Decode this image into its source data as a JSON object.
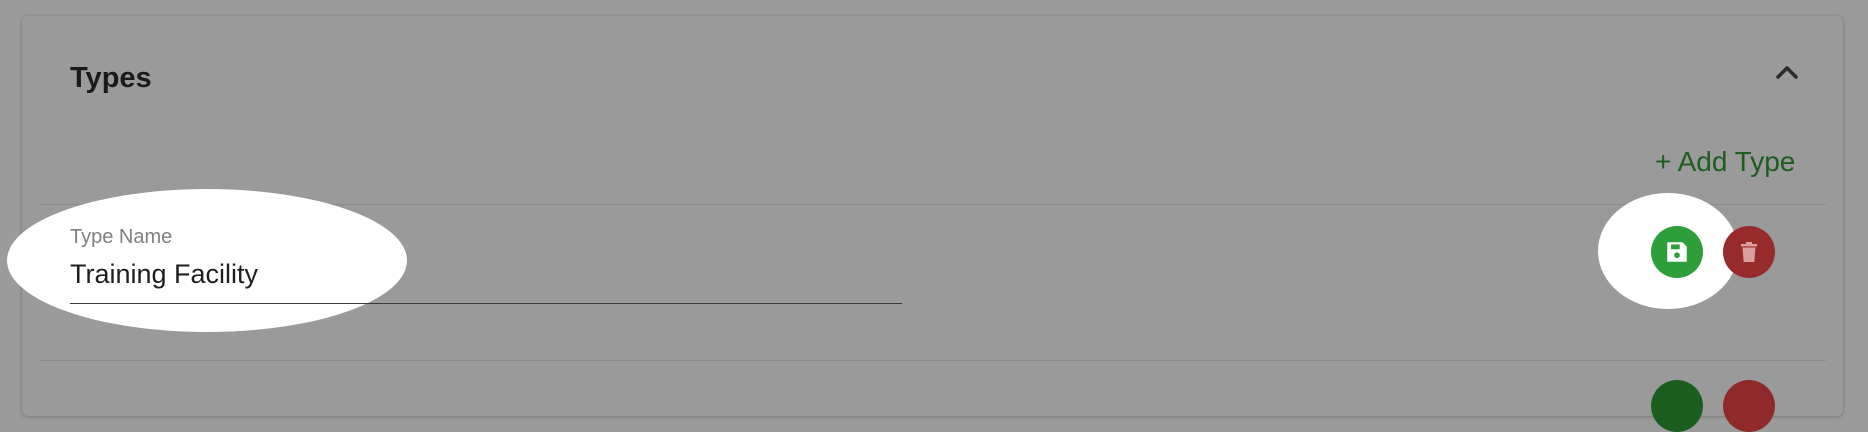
{
  "section": {
    "title": "Types",
    "collapse_icon": "chevron-up-icon",
    "add_label": "+ Add Type"
  },
  "type_row": {
    "field_label": "Type Name",
    "field_value": "Training Facility",
    "save_icon": "floppy-disk-icon",
    "delete_icon": "trash-icon"
  },
  "colors": {
    "overlay": "#9b9b9b",
    "add_text": "#1f5c1f",
    "save_button": "#2e9e3a",
    "delete_button": "#972b2b",
    "highlight": "#ffffff"
  }
}
